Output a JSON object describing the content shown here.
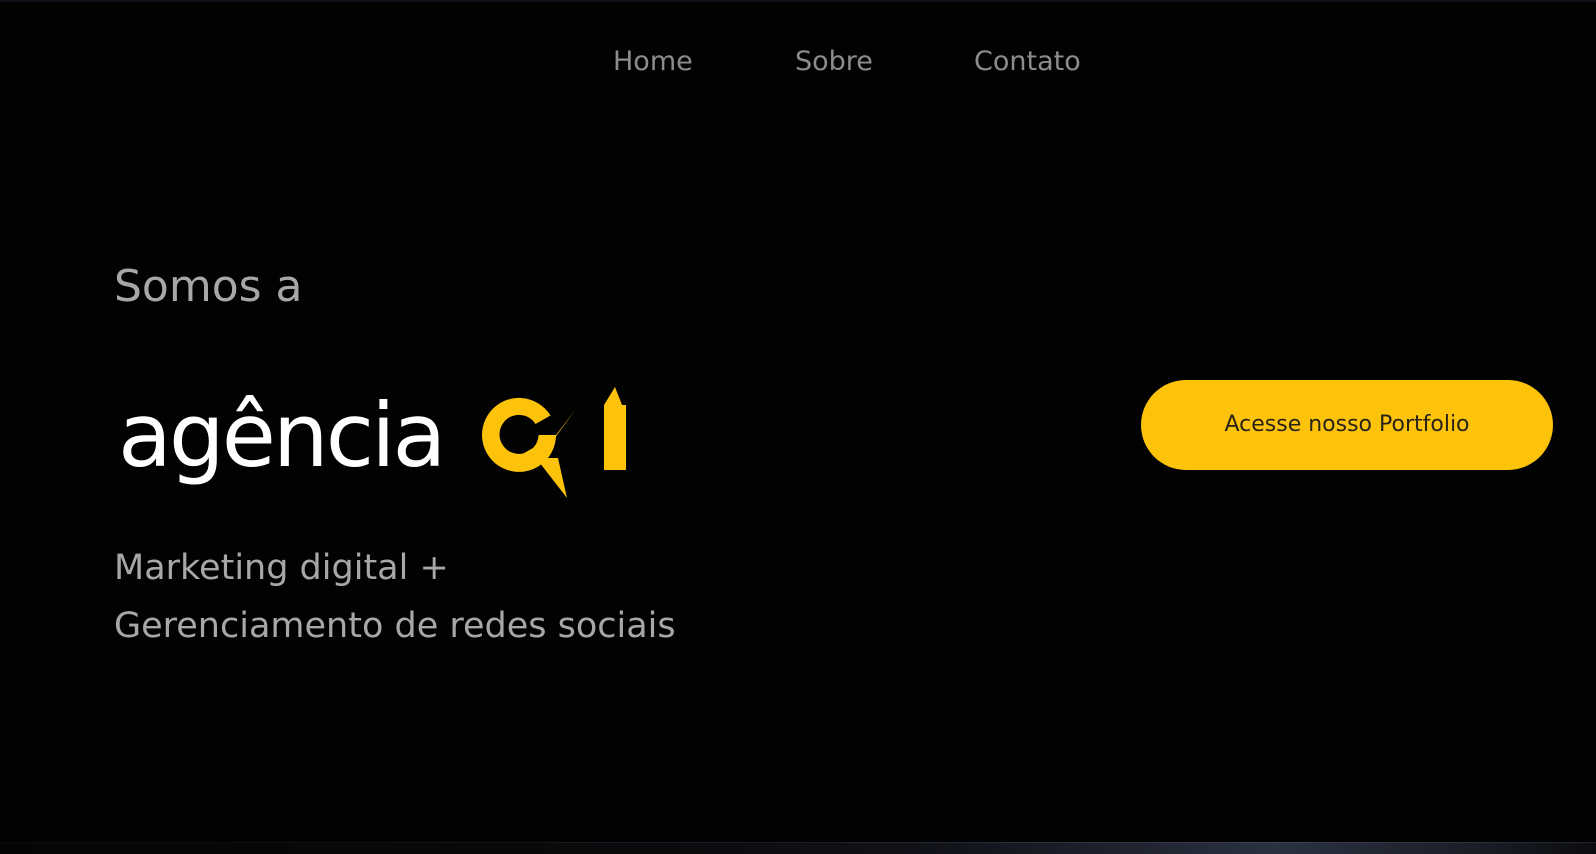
{
  "nav": {
    "items": [
      {
        "label": "Home"
      },
      {
        "label": "Sobre"
      },
      {
        "label": "Contato"
      }
    ]
  },
  "hero": {
    "intro": "Somos a",
    "logo": {
      "text": "agência",
      "mark": "Q1",
      "colors": {
        "text": "#ffffff",
        "mark": "#fdc20a"
      }
    },
    "tagline": {
      "line1": "Marketing digital +",
      "line2": "Gerenciamento de redes sociais"
    },
    "cta_label": "Acesse nosso Portfolio"
  },
  "colors": {
    "background": "#020203",
    "accent": "#fdc20a",
    "nav_text": "#8c8c8c",
    "body_text": "#a7a7a7"
  }
}
